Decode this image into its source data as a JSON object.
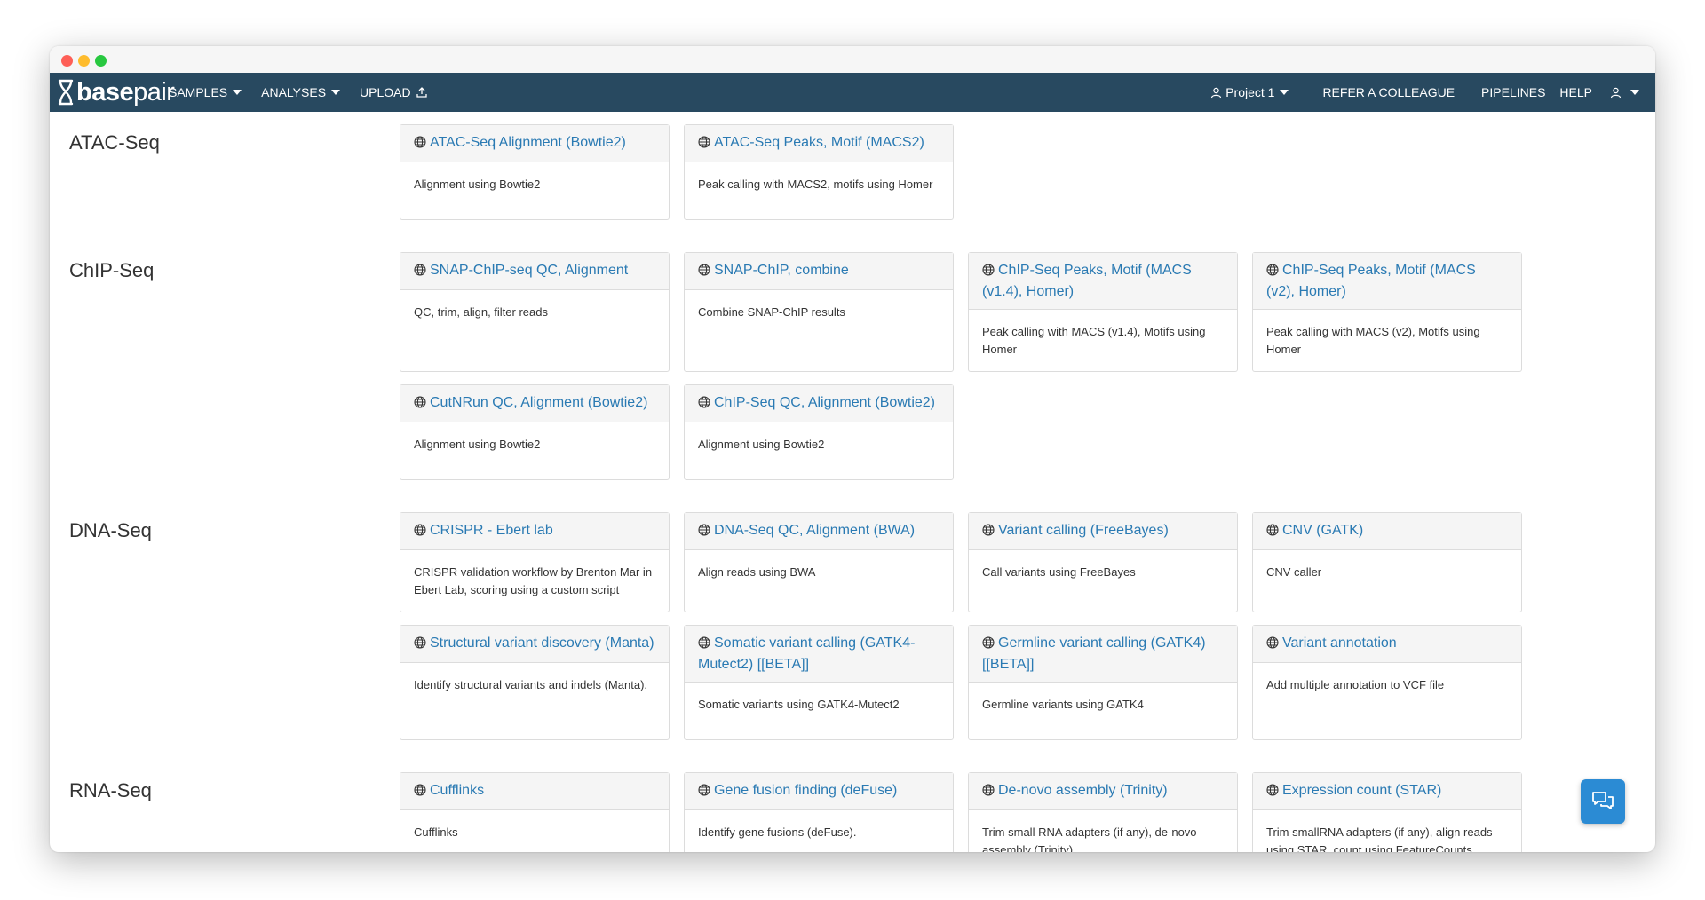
{
  "brand": {
    "bold": "base",
    "light": "pair"
  },
  "nav": {
    "samples": "SAMPLES",
    "analyses": "ANALYSES",
    "upload": "UPLOAD",
    "project": "Project 1",
    "refer": "REFER A COLLEAGUE",
    "pipelines": "PIPELINES",
    "help": "HELP"
  },
  "colors": {
    "navbar": "#284960",
    "link": "#2a7ab3",
    "chat": "#2b8bd4"
  },
  "sections": [
    {
      "title": "ATAC-Seq",
      "cards": [
        {
          "name": "ATAC-Seq Alignment (Bowtie2)",
          "desc": "Alignment using Bowtie2"
        },
        {
          "name": "ATAC-Seq Peaks, Motif (MACS2)",
          "desc": "Peak calling with MACS2, motifs using Homer"
        }
      ]
    },
    {
      "title": "ChIP-Seq",
      "cards": [
        {
          "name": "SNAP-ChIP-seq QC, Alignment",
          "desc": "QC, trim, align, filter reads"
        },
        {
          "name": "SNAP-ChIP, combine",
          "desc": "Combine SNAP-ChIP results"
        },
        {
          "name": "ChIP-Seq Peaks, Motif (MACS (v1.4), Homer)",
          "desc": "Peak calling with MACS (v1.4), Motifs using Homer"
        },
        {
          "name": "ChIP-Seq Peaks, Motif (MACS (v2), Homer)",
          "desc": "Peak calling with MACS (v2), Motifs using Homer"
        },
        {
          "name": "CutNRun QC, Alignment (Bowtie2)",
          "desc": "Alignment using Bowtie2"
        },
        {
          "name": "ChIP-Seq QC, Alignment (Bowtie2)",
          "desc": "Alignment using Bowtie2"
        }
      ]
    },
    {
      "title": "DNA-Seq",
      "cards": [
        {
          "name": "CRISPR - Ebert lab",
          "desc": "CRISPR validation workflow by Brenton Mar in Ebert Lab, scoring using a custom script"
        },
        {
          "name": "DNA-Seq QC, Alignment (BWA)",
          "desc": "Align reads using BWA"
        },
        {
          "name": "Variant calling (FreeBayes)",
          "desc": "Call variants using FreeBayes"
        },
        {
          "name": "CNV (GATK)",
          "desc": "CNV caller"
        },
        {
          "name": "Structural variant discovery (Manta)",
          "desc": "Identify structural variants and indels (Manta)."
        },
        {
          "name": "Somatic variant calling (GATK4-Mutect2) [[BETA]]",
          "desc": "Somatic variants using GATK4-Mutect2"
        },
        {
          "name": "Germline variant calling (GATK4) [[BETA]]",
          "desc": "Germline variants using GATK4"
        },
        {
          "name": "Variant annotation",
          "desc": "Add multiple annotation to VCF file"
        }
      ]
    },
    {
      "title": "RNA-Seq",
      "cards": [
        {
          "name": "Cufflinks",
          "desc": "Cufflinks"
        },
        {
          "name": "Gene fusion finding (deFuse)",
          "desc": "Identify gene fusions (deFuse)."
        },
        {
          "name": "De-novo assembly (Trinity)",
          "desc": "Trim small RNA adapters (if any), de-novo assembly (Trinity)."
        },
        {
          "name": "Expression count (STAR)",
          "desc": "Trim smallRNA adapters (if any), align reads using STAR, count using FeatureCounts"
        }
      ]
    }
  ]
}
